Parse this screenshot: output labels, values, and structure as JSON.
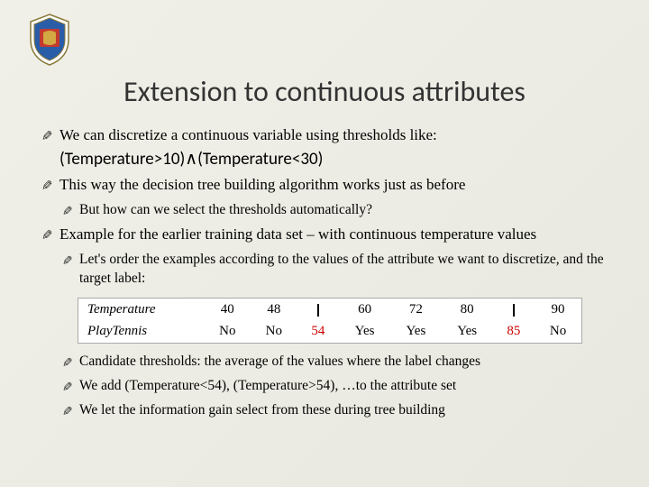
{
  "title": "Extension to continuous attributes",
  "bullets": {
    "b1": "We can discretize a continuous variable using thresholds like:",
    "formula": "(Temperature>10)∧(Temperature<30)",
    "b2": "This way the decision tree building algorithm works just as before",
    "b2a": "But how can we select the thresholds automatically?",
    "b3": "Example for the earlier training data set – with continuous temperature values",
    "b3a": "Let's order the examples according to the values of the attribute we want to discretize, and the target label:",
    "b4": "Candidate thresholds: the average of the values where the label changes",
    "b5": "We add (Temperature<54), (Temperature>54), …to the attribute set",
    "b6": "We let the information gain select from these during tree building"
  },
  "table": {
    "row1label": "Temperature",
    "row2label": "PlayTennis",
    "r1": {
      "c1": "40",
      "c2": "48",
      "c3": "60",
      "c4": "72",
      "c5": "80",
      "c6": "90"
    },
    "r2": {
      "c1": "No",
      "c2": "No",
      "m1": "54",
      "c3": "Yes",
      "c4": "Yes",
      "c5": "Yes",
      "m2": "85",
      "c6": "No"
    }
  }
}
